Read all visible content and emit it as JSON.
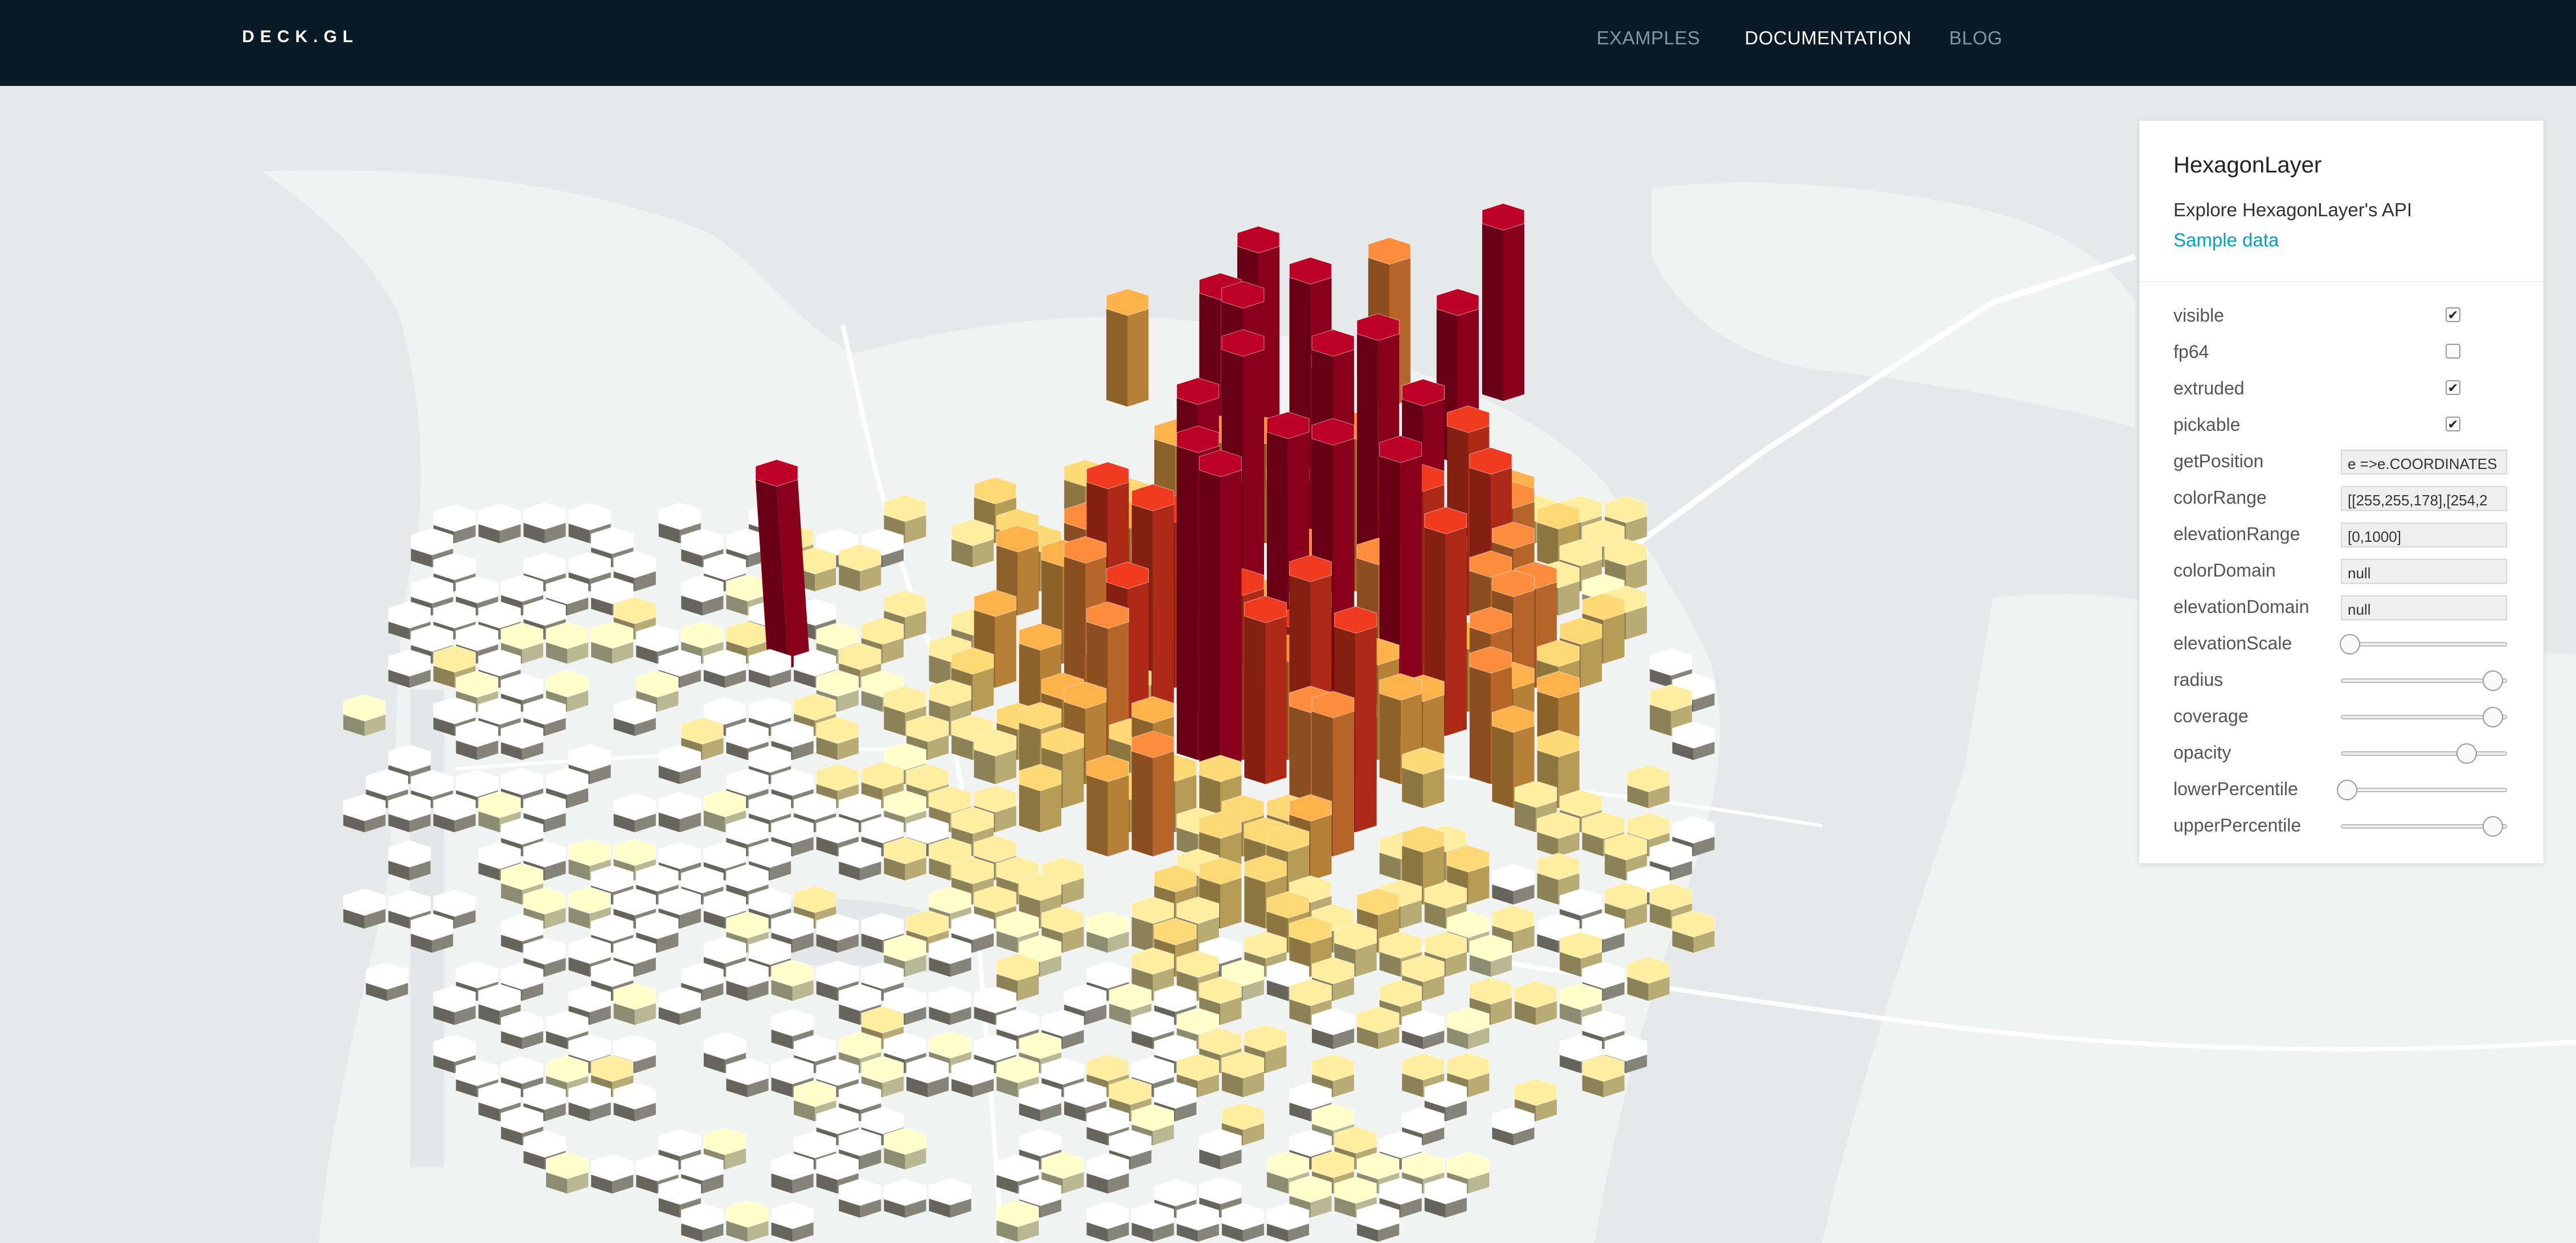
{
  "header": {
    "logo": "DECK.GL",
    "nav": [
      "EXAMPLES",
      "DOCUMENTATION",
      "BLOG"
    ]
  },
  "panel": {
    "title": "HexagonLayer",
    "description": "Explore HexagonLayer's API",
    "link": "Sample data",
    "properties": [
      {
        "label": "visible",
        "type": "checkbox",
        "checked": true
      },
      {
        "label": "fp64",
        "type": "checkbox",
        "checked": false
      },
      {
        "label": "extruded",
        "type": "checkbox",
        "checked": true
      },
      {
        "label": "pickable",
        "type": "checkbox",
        "checked": true
      },
      {
        "label": "getPosition",
        "type": "text",
        "value": "e =>e.COORDINATES"
      },
      {
        "label": "colorRange",
        "type": "text",
        "value": "[[255,255,178],[254,2"
      },
      {
        "label": "elevationRange",
        "type": "text",
        "value": "[0,1000]"
      },
      {
        "label": "colorDomain",
        "type": "text",
        "value": "null"
      },
      {
        "label": "elevationDomain",
        "type": "text",
        "value": "null"
      },
      {
        "label": "elevationScale",
        "type": "slider",
        "value": 0.05
      },
      {
        "label": "radius",
        "type": "slider",
        "value": 0.92
      },
      {
        "label": "coverage",
        "type": "slider",
        "value": 0.92
      },
      {
        "label": "opacity",
        "type": "slider",
        "value": 0.76
      },
      {
        "label": "lowerPercentile",
        "type": "slider",
        "value": 0.03
      },
      {
        "label": "upperPercentile",
        "type": "slider",
        "value": 0.92
      }
    ]
  },
  "map": {
    "background_color": "#e6e9e9",
    "land_color": "#f1f3f3",
    "road_color": "#ffffff",
    "color_range": [
      "#ffffcc",
      "#ffeda0",
      "#fed976",
      "#feb24c",
      "#fd8d3c",
      "#f03b20",
      "#bd0026"
    ]
  }
}
